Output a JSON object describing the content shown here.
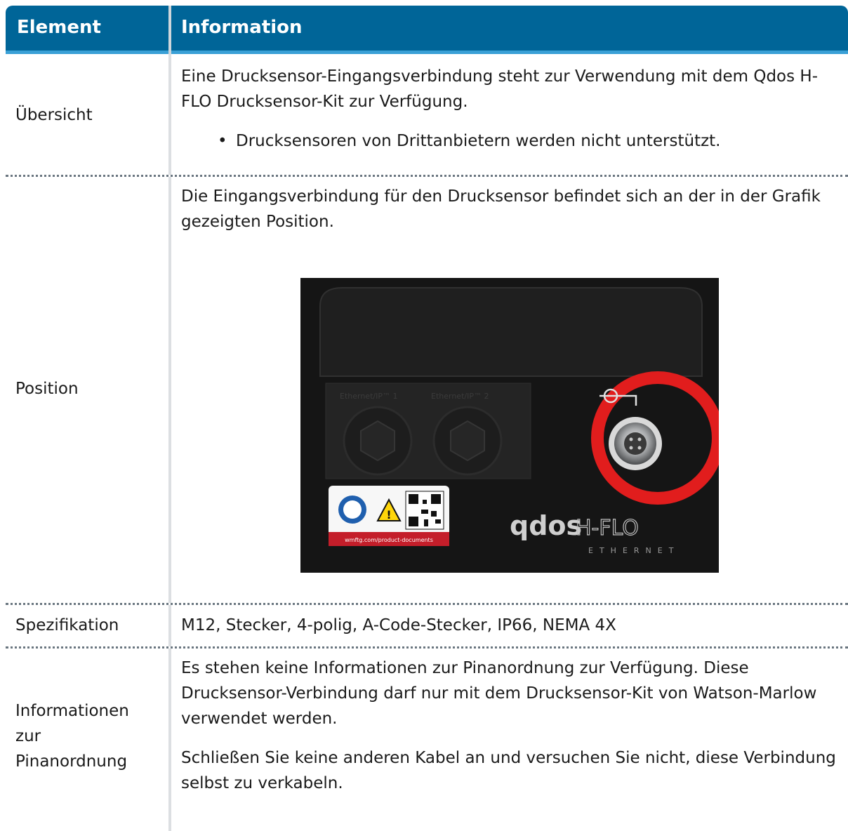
{
  "table": {
    "header": {
      "col1": "Element",
      "col2": "Information"
    },
    "rows": [
      {
        "label": "Übersicht",
        "paragraph": "Eine Drucksensor-Eingangsverbindung steht zur Verwendung mit dem Qdos H-FLO Drucksensor-Kit zur Verfügung.",
        "bullet": "Drucksensoren von Drittanbietern werden nicht unterstützt."
      },
      {
        "label": "Position",
        "paragraph": "Die Eingangsverbindung für den Drucksensor befindet sich an der in der Grafik gezeigten Position.",
        "image": {
          "brand": "qdos",
          "model": "H-FLO",
          "subtitle": "ETHERNET",
          "port1": "Ethernet/IP™ 1",
          "port2": "Ethernet/IP™ 2",
          "label_url": "wmftg.com/product-documents",
          "highlight_color": "#e11d1d"
        }
      },
      {
        "label": "Spezifikation",
        "paragraph": "M12, Stecker, 4-polig, A-Code-Stecker, IP66, NEMA 4X"
      },
      {
        "label": "Informationen zur Pinanordnung",
        "paragraph1": "Es stehen keine Informationen zur Pinanordnung zur Verfügung. Diese Drucksensor-Verbindung darf nur mit dem Drucksensor-Kit von Watson-Marlow verwendet werden.",
        "paragraph2": "Schließen Sie keine anderen Kabel an und versuchen Sie nicht, diese Verbindung selbst zu verkabeln."
      }
    ]
  },
  "colors": {
    "header_bg": "#006598",
    "header_accent": "#3aa0d6",
    "separator": "#6a7680"
  }
}
